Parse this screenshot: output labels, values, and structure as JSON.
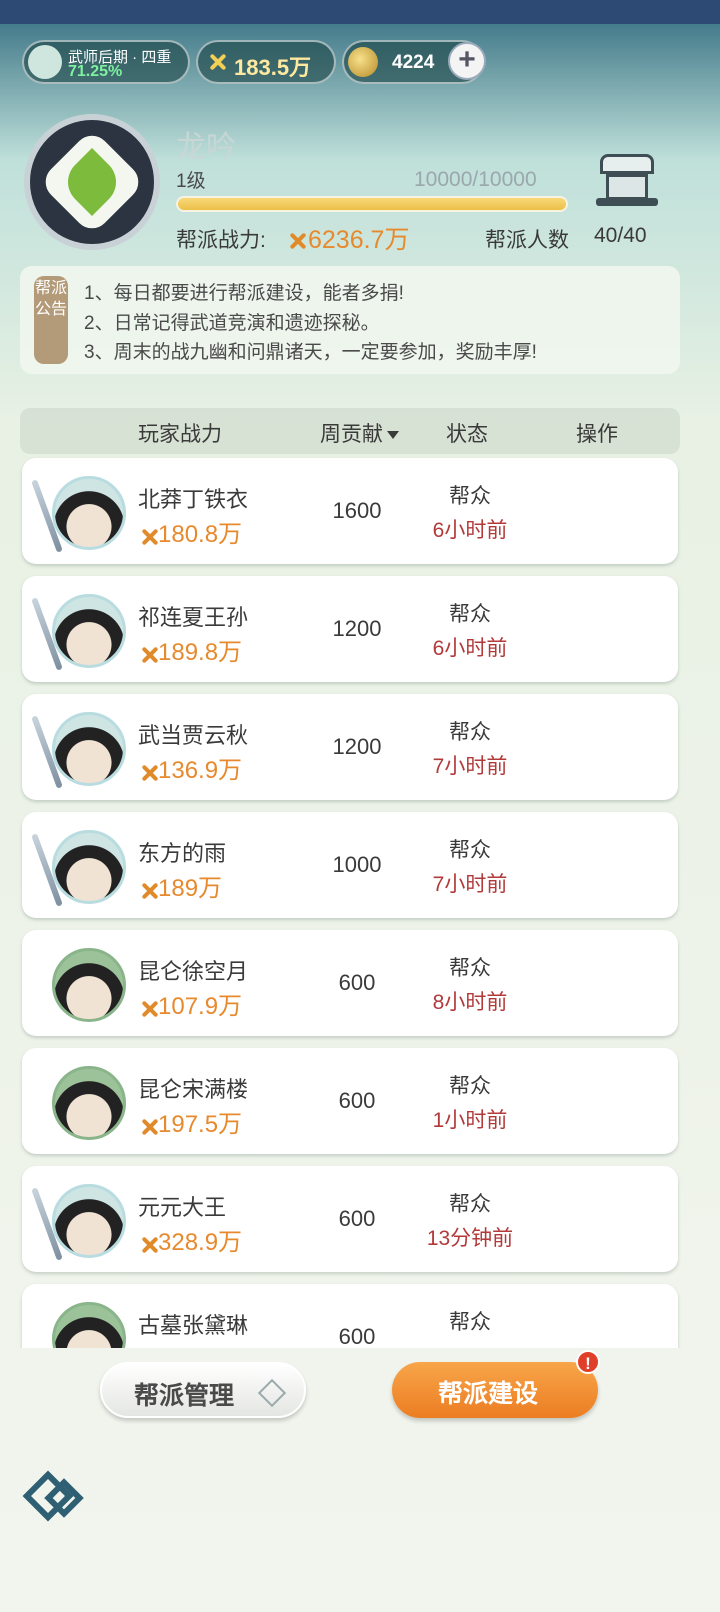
{
  "topbar": {
    "rank_title": "武师后期 · 四重",
    "rank_percent": "71.25%",
    "power": "183.5万",
    "coins": "4224",
    "add_label": "+"
  },
  "guild": {
    "name": "龙吟",
    "level": "1级",
    "exp": "10000/10000",
    "exp_progress": 1.0,
    "power_label": "帮派战力:",
    "power_value": "6236.7万",
    "members_label": "帮派人数",
    "members_value": "40/40"
  },
  "announcement": {
    "tag": "帮派公告",
    "lines": [
      "1、每日都要进行帮派建设，能者多捐!",
      "2、日常记得武道竞演和遗迹探秘。",
      "3、周末的战九幽和问鼎诸天，一定要参加，奖励丰厚!"
    ]
  },
  "table": {
    "headers": {
      "power": "玩家战力",
      "contribution": "周贡献",
      "status": "状态",
      "action": "操作"
    },
    "rows": [
      {
        "name": "北莽丁铁衣",
        "power": "180.8万",
        "contribution": "1600",
        "role": "帮众",
        "time": "6小时前"
      },
      {
        "name": "祁连夏王孙",
        "power": "189.8万",
        "contribution": "1200",
        "role": "帮众",
        "time": "6小时前"
      },
      {
        "name": "武当贾云秋",
        "power": "136.9万",
        "contribution": "1200",
        "role": "帮众",
        "time": "7小时前"
      },
      {
        "name": "东方的雨",
        "power": "189万",
        "contribution": "1000",
        "role": "帮众",
        "time": "7小时前"
      },
      {
        "name": "昆仑徐空月",
        "power": "107.9万",
        "contribution": "600",
        "role": "帮众",
        "time": "8小时前"
      },
      {
        "name": "昆仑宋满楼",
        "power": "197.5万",
        "contribution": "600",
        "role": "帮众",
        "time": "1小时前"
      },
      {
        "name": "元元大王",
        "power": "328.9万",
        "contribution": "600",
        "role": "帮众",
        "time": "13分钟前"
      },
      {
        "name": "古墓张黛琳",
        "power": "",
        "contribution": "600",
        "role": "帮众",
        "time": ""
      }
    ]
  },
  "buttons": {
    "manage": "帮派管理",
    "build": "帮派建设",
    "build_badge": "!"
  },
  "colors": {
    "accent_orange": "#e7892d",
    "time_red": "#b23a3a",
    "button_orange": "#ec7d22"
  }
}
